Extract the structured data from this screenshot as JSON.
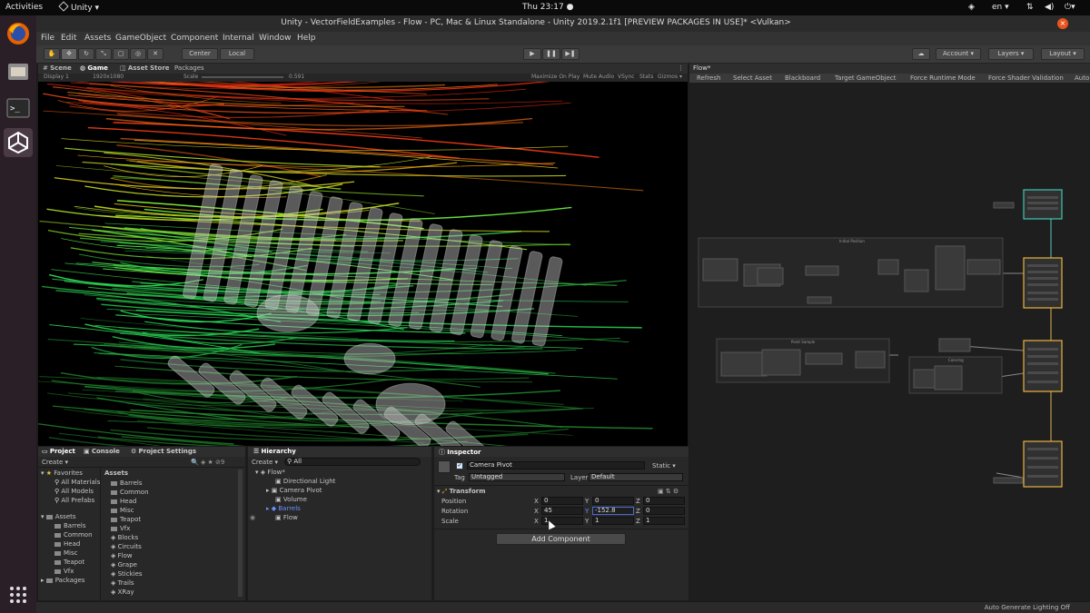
{
  "os_bar": {
    "activities": "Activities",
    "app_menu": "Unity ▾",
    "clock": "Thu 23:17 ●",
    "lang": "en ▾"
  },
  "window": {
    "title": "Unity - VectorFieldExamples - Flow - PC, Mac & Linux Standalone - Unity 2019.2.1f1 [PREVIEW PACKAGES IN USE]* <Vulkan>"
  },
  "menu": [
    "File",
    "Edit",
    "Assets",
    "GameObject",
    "Component",
    "Internal",
    "Window",
    "Help"
  ],
  "toolbar": {
    "center": "Center",
    "local": "Local",
    "account": "Account",
    "layers": "Layers",
    "layout": "Layout"
  },
  "game_panel": {
    "tabs": [
      "Scene",
      "Game",
      "Asset Store",
      "Packages"
    ],
    "display": "Display 1",
    "resolution": "1920x1080",
    "scale_label": "Scale",
    "scale_value": "0.591",
    "options": [
      "Maximize On Play",
      "Mute Audio",
      "VSync",
      "Stats",
      "Gizmos ▾"
    ]
  },
  "graph_panel": {
    "tab": "Flow*",
    "toolbar": [
      "Refresh",
      "Select Asset",
      "Blackboard",
      "Target GameObject",
      "Force Runtime Mode",
      "Force Shader Validation",
      "Auto"
    ],
    "groups": [
      "Initial Position",
      "Point Sample",
      "Coloring"
    ]
  },
  "project_panel": {
    "tabs": [
      "Project",
      "Console",
      "Project Settings"
    ],
    "create": "Create ▾",
    "favorites_label": "Favorites",
    "favorites": [
      "All Materials",
      "All Models",
      "All Prefabs"
    ],
    "assets_label": "Assets",
    "tree_assets": [
      "Barrels",
      "Common",
      "Head",
      "Misc",
      "Teapot",
      "Vfx"
    ],
    "packages_label": "Packages",
    "right_header": "Assets",
    "right_items": [
      "Barrels",
      "Common",
      "Head",
      "Misc",
      "Teapot",
      "Vfx",
      "Blocks",
      "Circuits",
      "Flow",
      "Grape",
      "Stickies",
      "Trails",
      "XRay"
    ]
  },
  "hierarchy_panel": {
    "tab": "Hierarchy",
    "create": "Create ▾",
    "search": "All",
    "scene": "Flow*",
    "items": [
      "Directional Light",
      "Camera Pivot",
      "Volume",
      "Barrels",
      "Flow"
    ]
  },
  "inspector": {
    "tab": "Inspector",
    "object_name": "Camera Pivot",
    "static": "Static",
    "tag_label": "Tag",
    "tag_value": "Untagged",
    "layer_label": "Layer",
    "layer_value": "Default",
    "component": "Transform",
    "rows": [
      {
        "label": "Position",
        "x": "0",
        "y": "0",
        "z": "0"
      },
      {
        "label": "Rotation",
        "x": "45",
        "y": "-152.8",
        "z": "0"
      },
      {
        "label": "Scale",
        "x": "1",
        "y": "1",
        "z": "1"
      }
    ],
    "add_component": "Add Component"
  },
  "status": {
    "text": "Auto Generate Lighting Off"
  }
}
